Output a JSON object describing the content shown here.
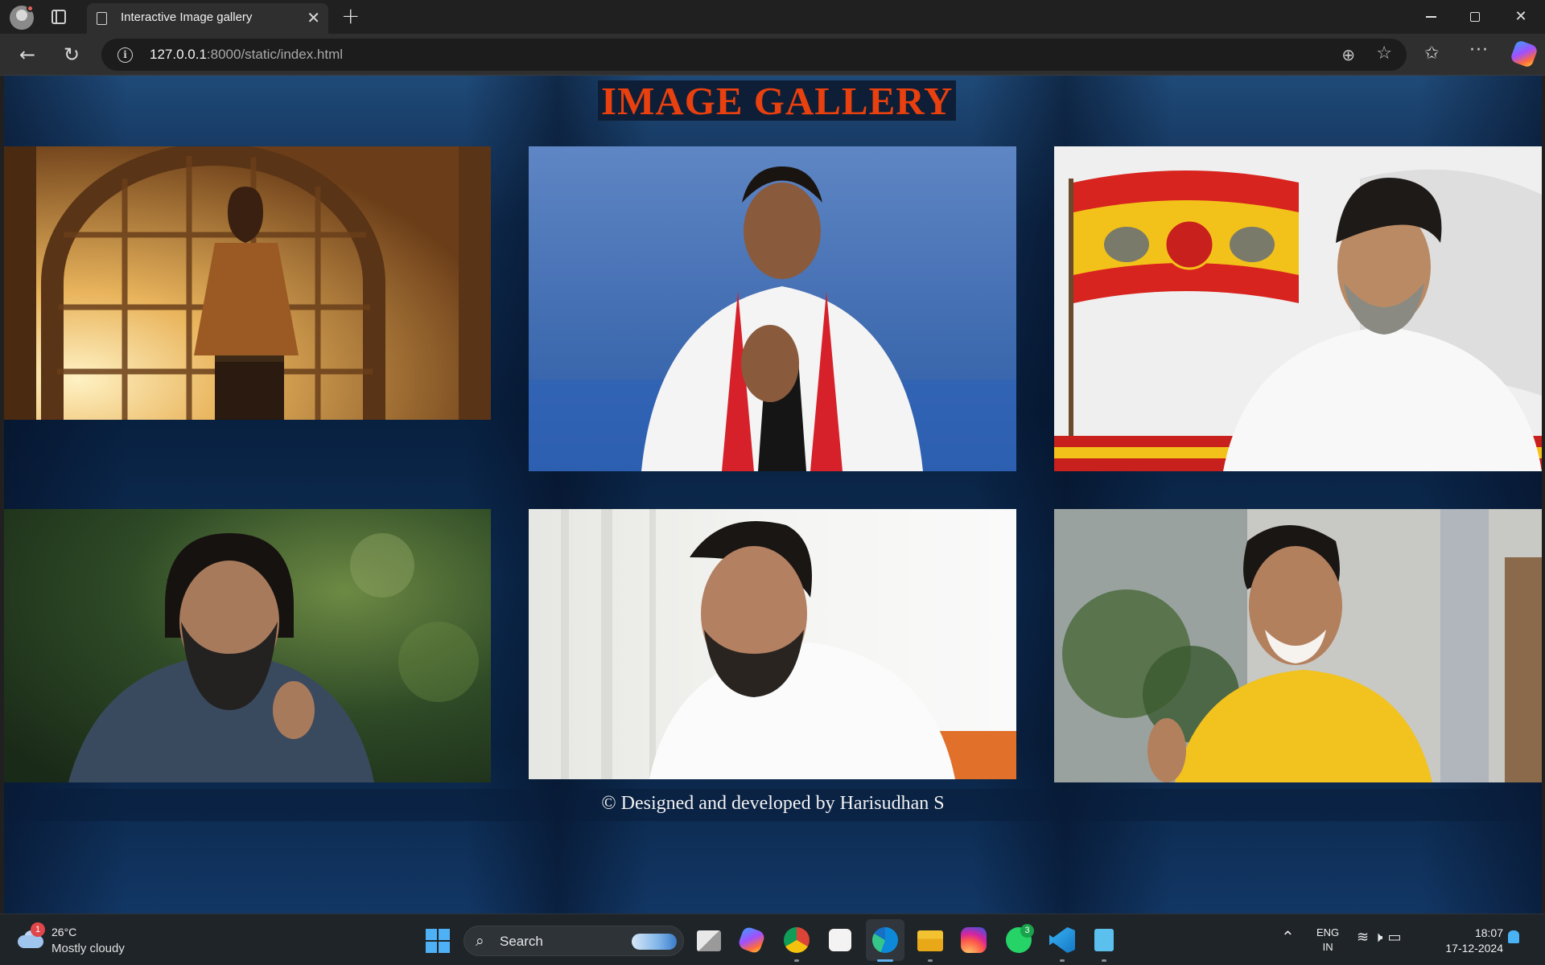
{
  "browser": {
    "tab_title": "Interactive Image gallery",
    "tab_close_glyph": "✕",
    "new_tab_glyph": "+",
    "url_host": "127.0.0.1",
    "url_rest": ":8000/static/index.html",
    "window_controls": [
      "minimize",
      "restore",
      "close"
    ]
  },
  "page": {
    "title": "IMAGE GALLERY",
    "footer": "© Designed and developed by Harisudhan S",
    "title_color": "#e8400e",
    "photos": [
      {
        "subject": "man in brown shirt standing before arched window"
      },
      {
        "subject": "man in white shirt with red and black scarf, hands folded"
      },
      {
        "subject": "smiling man in white shirt beside red and yellow flag"
      },
      {
        "subject": "bearded man with long hair in dark shirt"
      },
      {
        "subject": "man with beard in white shirt, portrait"
      },
      {
        "subject": "smiling man in yellow shirt pointing"
      }
    ]
  },
  "taskbar": {
    "weather": {
      "temp": "26°C",
      "desc": "Mostly cloudy",
      "badge": "1"
    },
    "search_label": "Search",
    "apps": [
      "task-view",
      "copilot",
      "chrome",
      "store",
      "edge",
      "file-explorer",
      "instagram",
      "whatsapp",
      "vscode",
      "notepad"
    ],
    "whatsapp_badge": "3",
    "lang_line1": "ENG",
    "lang_line2": "IN",
    "time": "18:07",
    "date": "17-12-2024"
  }
}
